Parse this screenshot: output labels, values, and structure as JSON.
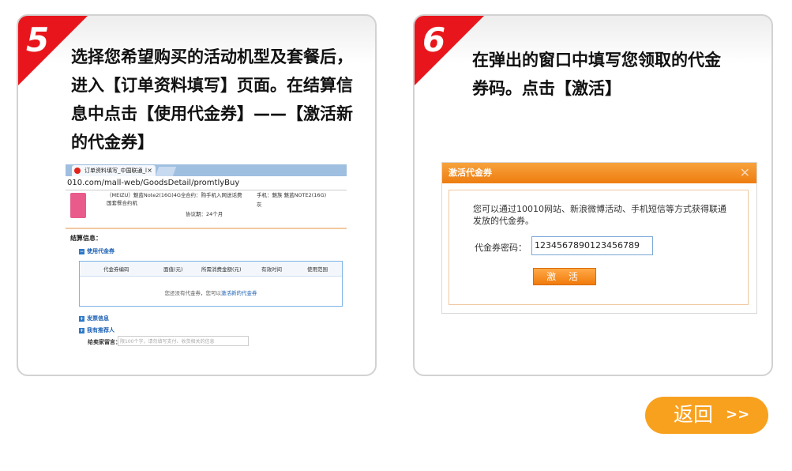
{
  "step5": {
    "number": "5",
    "instruction": "选择您希望购买的活动机型及套餐后，进入【订单资料填写】页面。在结算信息中点击【使用代金券】——【激活新的代金券】",
    "screenshot": {
      "tab_title": "订单资料填写_中国联通_l",
      "tab_close": "×",
      "address": "010.com/mall-web/GoodsDetail/promtlyBuy",
      "product_line1": "（MEIZU）魅蓝Note2(16G)4G全",
      "product_line2": "国套餐合约机",
      "contract_label": "合约：购手机入网送话费",
      "contract_term": "协议期：24个月",
      "phone_spec": "手机：魅族 魅蓝NOTE2(16G)",
      "phone_color": "灰",
      "section_title": "结算信息：",
      "use_voucher": "使用代金券",
      "table_headers": [
        "代金券编码",
        "面值(元)",
        "所需消费金额(元)",
        "有效时间",
        "使用范围"
      ],
      "empty_prefix": "您还没有代金券，您可以",
      "empty_link": "激活新的代金券",
      "invoice": "发票信息",
      "recommender": "我有推荐人",
      "message_label": "给卖家留言：",
      "message_placeholder": "限100个字，请勿填写支付、收货相关的信息"
    }
  },
  "step6": {
    "number": "6",
    "instruction": "在弹出的窗口中填写您领取的代金券码。点击【激活】",
    "dialog": {
      "title": "激活代金券",
      "close": "✕",
      "description": "您可以通过10010网站、新浪微博活动、手机短信等方式获得联通发放的代金券。",
      "code_label": "代金券密码：",
      "code_value": "1234567890123456789",
      "activate_button": "激 活"
    }
  },
  "back_button": {
    "label": "返回",
    "arrow": ">>"
  },
  "colors": {
    "accent_red": "#e8161c",
    "accent_orange": "#f8a11f",
    "link_blue": "#1a5fb4"
  }
}
